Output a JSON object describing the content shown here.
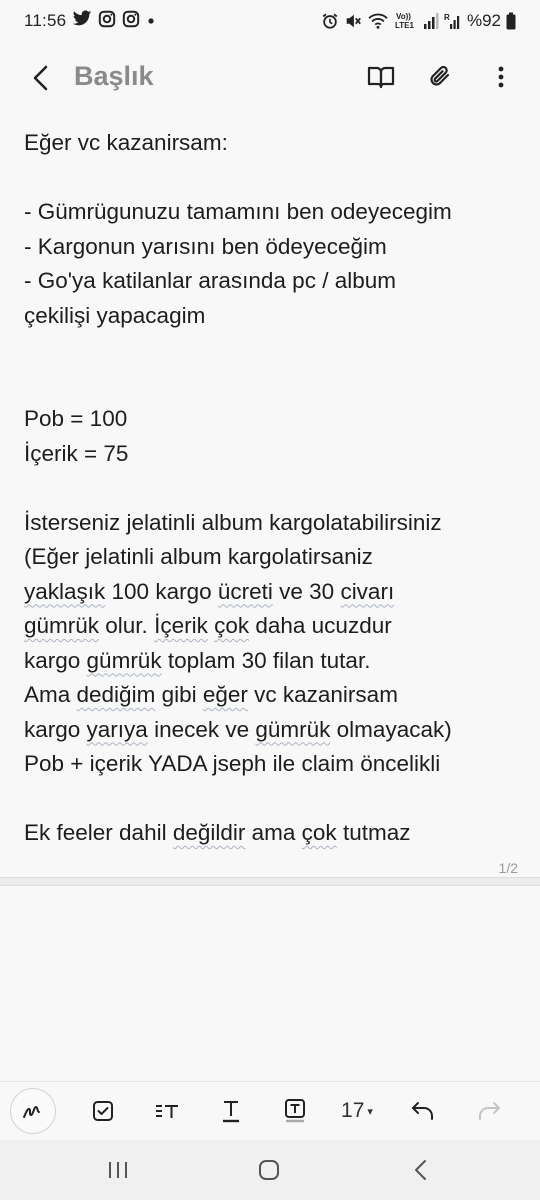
{
  "status_bar": {
    "time": "11:56",
    "notification_icons": [
      "twitter-icon",
      "instagram-icon",
      "instagram-icon",
      "dot-icon"
    ],
    "system_icons": [
      "alarm-icon",
      "mute-icon",
      "wifi-icon",
      "volte-lte-icon",
      "signal-icon",
      "roaming-signal-icon"
    ],
    "volte_label": "Vo)) LTE1",
    "roaming_label": "R",
    "battery_text": "%92"
  },
  "app_bar": {
    "title": "Başlık",
    "actions": [
      "book-icon",
      "paperclip-icon",
      "more-vert-icon"
    ]
  },
  "note": {
    "line_1": "Eğer vc kazanirsam:",
    "line_3": "- Gümrügunuzu tamamını ben odeyecegim",
    "line_4": "- Kargonun yarısını ben ödeyeceğim",
    "line_5": "-  Go'ya katilanlar arasında pc / album",
    "line_6": "çekilişi yapacagim",
    "line_9": "Pob = 100",
    "line_10": "İçerik = 75",
    "line_12": "İsterseniz jelatinli album kargolatabilirsiniz",
    "line_13": "(Eğer jelatinli album kargolatirsaniz",
    "line_14_a": "yaklaşık",
    "line_14_b": " 100 kargo ",
    "line_14_c": "ücreti",
    "line_14_d": " ve 30 ",
    "line_14_e": "civarı",
    "line_15_a": "gümrük",
    "line_15_b": " olur. ",
    "line_15_c": "İçerik",
    "line_15_d": " ",
    "line_15_e": "çok",
    "line_15_f": " daha ucuzdur",
    "line_16_a": "kargo ",
    "line_16_b": "gümrük",
    "line_16_c": " toplam 30 filan tutar.",
    "line_17_a": "Ama ",
    "line_17_b": "dediğim",
    "line_17_c": " gibi ",
    "line_17_d": "eğer",
    "line_17_e": " vc kazanirsam",
    "line_18_a": "kargo ",
    "line_18_b": "yarıya",
    "line_18_c": " inecek ve ",
    "line_18_d": "gümrük",
    "line_18_e": " olmayacak)",
    "line_19": "Pob + içerik YADA jseph ile claim öncelikli",
    "line_21_a": "Ek feeler dahil ",
    "line_21_b": "değildir",
    "line_21_c": " ama ",
    "line_21_d": "çok",
    "line_21_e": " tutmaz"
  },
  "page_indicator": "1/2",
  "toolbar": {
    "font_size_value": "17",
    "font_size_caret": "▾",
    "tools": [
      "pen-mode-icon",
      "checkbox-icon",
      "text-style-icon",
      "underline-icon",
      "text-background-icon",
      "undo-icon",
      "redo-icon"
    ]
  },
  "nav_bar": {
    "buttons": [
      "recent-apps-icon",
      "home-icon",
      "back-icon"
    ]
  }
}
